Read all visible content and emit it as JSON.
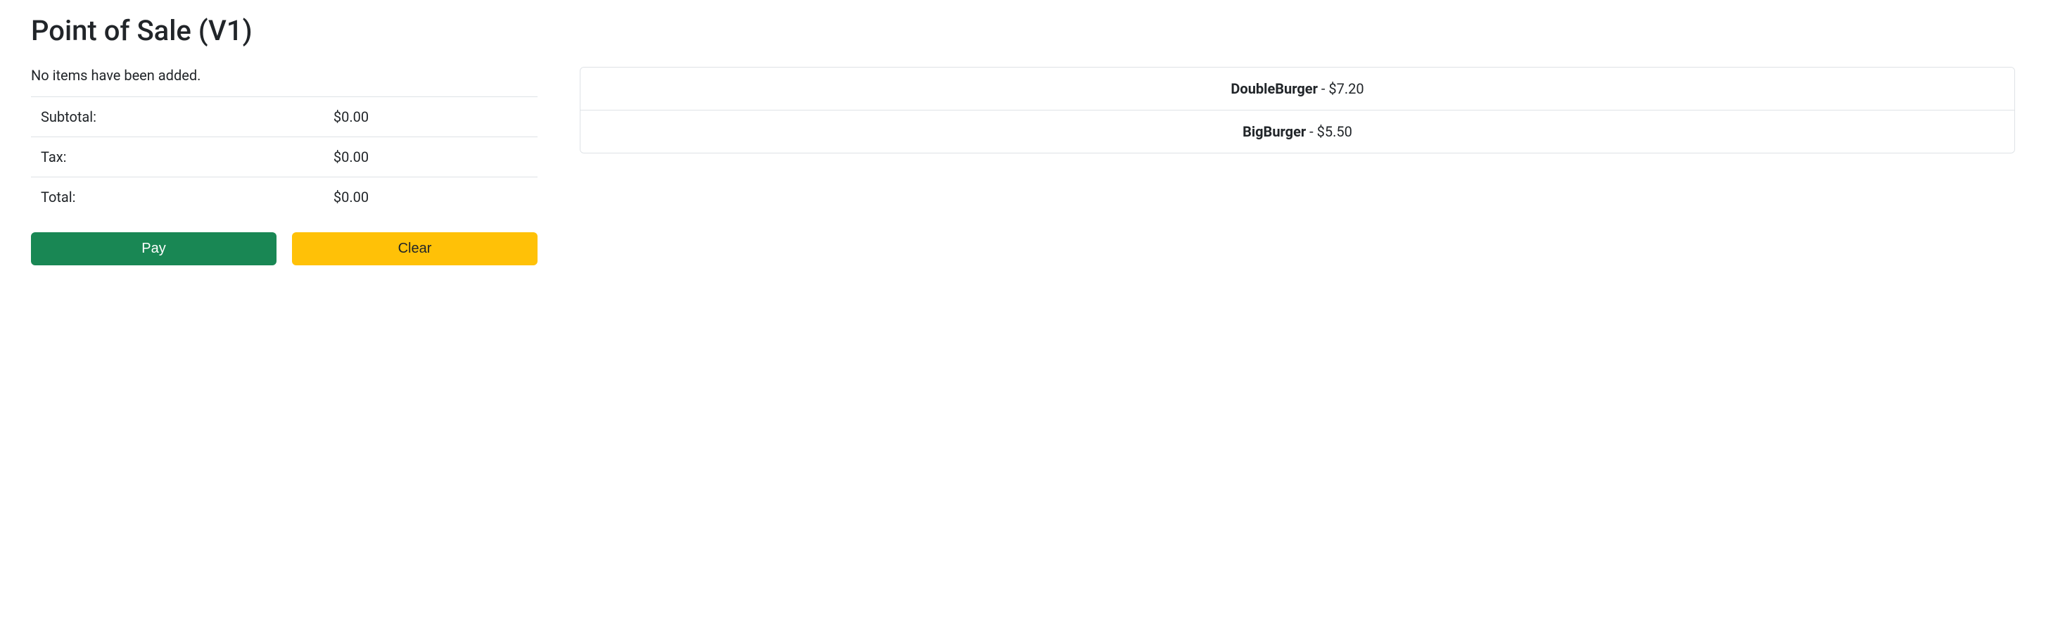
{
  "header": {
    "title": "Point of Sale (V1)"
  },
  "cart": {
    "empty_message": "No items have been added.",
    "rows": [
      {
        "label": "Subtotal:",
        "value": "$0.00"
      },
      {
        "label": "Tax:",
        "value": "$0.00"
      },
      {
        "label": "Total:",
        "value": "$0.00"
      }
    ]
  },
  "buttons": {
    "pay_label": "Pay",
    "clear_label": "Clear"
  },
  "products": [
    {
      "name": "DoubleBurger",
      "sep": " - ",
      "price": "$7.20"
    },
    {
      "name": "BigBurger",
      "sep": " - ",
      "price": "$5.50"
    }
  ]
}
